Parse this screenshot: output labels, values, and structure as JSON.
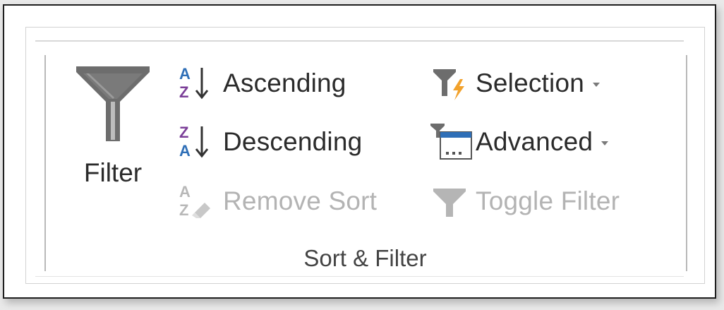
{
  "ribbon_group": {
    "title": "Sort & Filter",
    "filter": {
      "label": "Filter",
      "icon": "funnel-icon"
    },
    "sort": {
      "ascending": {
        "label": "Ascending",
        "icon": "sort-ascending-icon",
        "glyph_top": "A",
        "glyph_bottom": "Z"
      },
      "descending": {
        "label": "Descending",
        "icon": "sort-descending-icon",
        "glyph_top": "Z",
        "glyph_bottom": "A"
      },
      "remove_sort": {
        "label": "Remove Sort",
        "icon": "remove-sort-icon",
        "glyph_top": "A",
        "glyph_bottom": "Z",
        "enabled": false
      }
    },
    "filter_commands": {
      "selection": {
        "label": "Selection",
        "icon": "filter-selection-icon",
        "has_dropdown": true
      },
      "advanced": {
        "label": "Advanced",
        "icon": "advanced-filter-icon",
        "has_dropdown": true
      },
      "toggle_filter": {
        "label": "Toggle Filter",
        "icon": "toggle-filter-icon",
        "enabled": false
      }
    }
  },
  "colors": {
    "text": "#2b2b2b",
    "disabled_text": "#b3b3b3",
    "funnel": "#6d6d6d",
    "sort_blue": "#2f6fb7",
    "sort_purple": "#7b3f98",
    "lightning_orange": "#f2a22c",
    "group_label": "#444444"
  }
}
